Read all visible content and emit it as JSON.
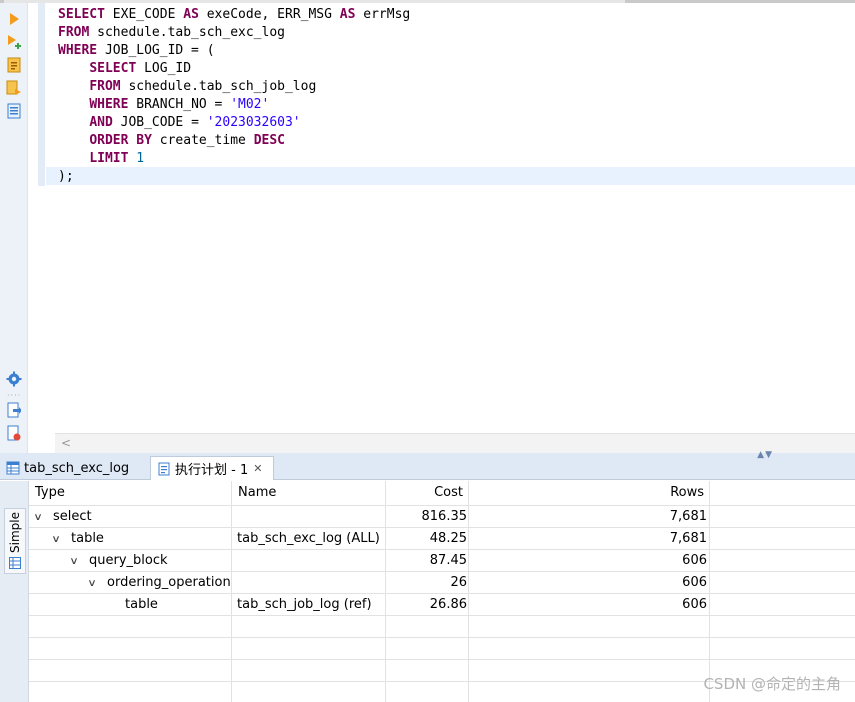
{
  "sql": {
    "lines": [
      [
        {
          "t": "SELECT",
          "c": "kw"
        },
        {
          "t": " EXE_CODE "
        },
        {
          "t": "AS",
          "c": "kw"
        },
        {
          "t": " exeCode, ERR_MSG "
        },
        {
          "t": "AS",
          "c": "kw"
        },
        {
          "t": " errMsg"
        }
      ],
      [
        {
          "t": "FROM",
          "c": "kw"
        },
        {
          "t": " schedule.tab_sch_exc_log"
        }
      ],
      [
        {
          "t": "WHERE",
          "c": "kw"
        },
        {
          "t": " JOB_LOG_ID = ("
        }
      ],
      [
        {
          "t": "    "
        },
        {
          "t": "SELECT",
          "c": "kw"
        },
        {
          "t": " LOG_ID"
        }
      ],
      [
        {
          "t": "    "
        },
        {
          "t": "FROM",
          "c": "kw"
        },
        {
          "t": " schedule.tab_sch_job_log"
        }
      ],
      [
        {
          "t": "    "
        },
        {
          "t": "WHERE",
          "c": "kw"
        },
        {
          "t": " BRANCH_NO = "
        },
        {
          "t": "'M02'",
          "c": "str"
        }
      ],
      [
        {
          "t": "    "
        },
        {
          "t": "AND",
          "c": "kw"
        },
        {
          "t": " JOB_CODE = "
        },
        {
          "t": "'2023032603'",
          "c": "str"
        }
      ],
      [
        {
          "t": "    "
        },
        {
          "t": "ORDER BY",
          "c": "kw"
        },
        {
          "t": " create_time "
        },
        {
          "t": "DESC",
          "c": "kw"
        }
      ],
      [
        {
          "t": "    "
        },
        {
          "t": "LIMIT",
          "c": "kw"
        },
        {
          "t": " "
        },
        {
          "t": "1",
          "c": "num"
        }
      ],
      [
        {
          "t": ");"
        }
      ]
    ]
  },
  "toolbar_icons": [
    "execute-icon",
    "execute-script-icon",
    "explain-plan-icon",
    "load-plan-icon",
    "format-sql-icon"
  ],
  "lower_toolbar_icons": [
    "settings-icon",
    "export-icon",
    "error-log-icon"
  ],
  "tabs": [
    {
      "label": "tab_sch_exc_log",
      "icon": "table-grid-icon"
    },
    {
      "label": "执行计划 - 1",
      "icon": "plan-document-icon",
      "close": "✕",
      "active": true
    }
  ],
  "side_tab": {
    "label": "Simple",
    "icon": "grid-icon"
  },
  "plan": {
    "columns": [
      "Type",
      "Name",
      "Cost",
      "Rows"
    ],
    "rows": [
      {
        "level": 0,
        "expanded": true,
        "type": "select",
        "name": "",
        "cost": "816.35",
        "rows": "7,681"
      },
      {
        "level": 1,
        "expanded": true,
        "type": "table",
        "name": "tab_sch_exc_log (ALL)",
        "cost": "48.25",
        "rows": "7,681"
      },
      {
        "level": 2,
        "expanded": true,
        "type": "query_block",
        "name": "",
        "cost": "87.45",
        "rows": "606"
      },
      {
        "level": 3,
        "expanded": true,
        "type": "ordering_operation",
        "name": "",
        "cost": "26",
        "rows": "606"
      },
      {
        "level": 4,
        "expanded": false,
        "type": "table",
        "name": "tab_sch_job_log (ref)",
        "cost": "26.86",
        "rows": "606"
      }
    ]
  },
  "watermark": "CSDN @命定的主角",
  "colors": {
    "keyword": "#7f0055",
    "string": "#2a00ff",
    "number": "#006699",
    "accent": "#3b7fd1"
  }
}
